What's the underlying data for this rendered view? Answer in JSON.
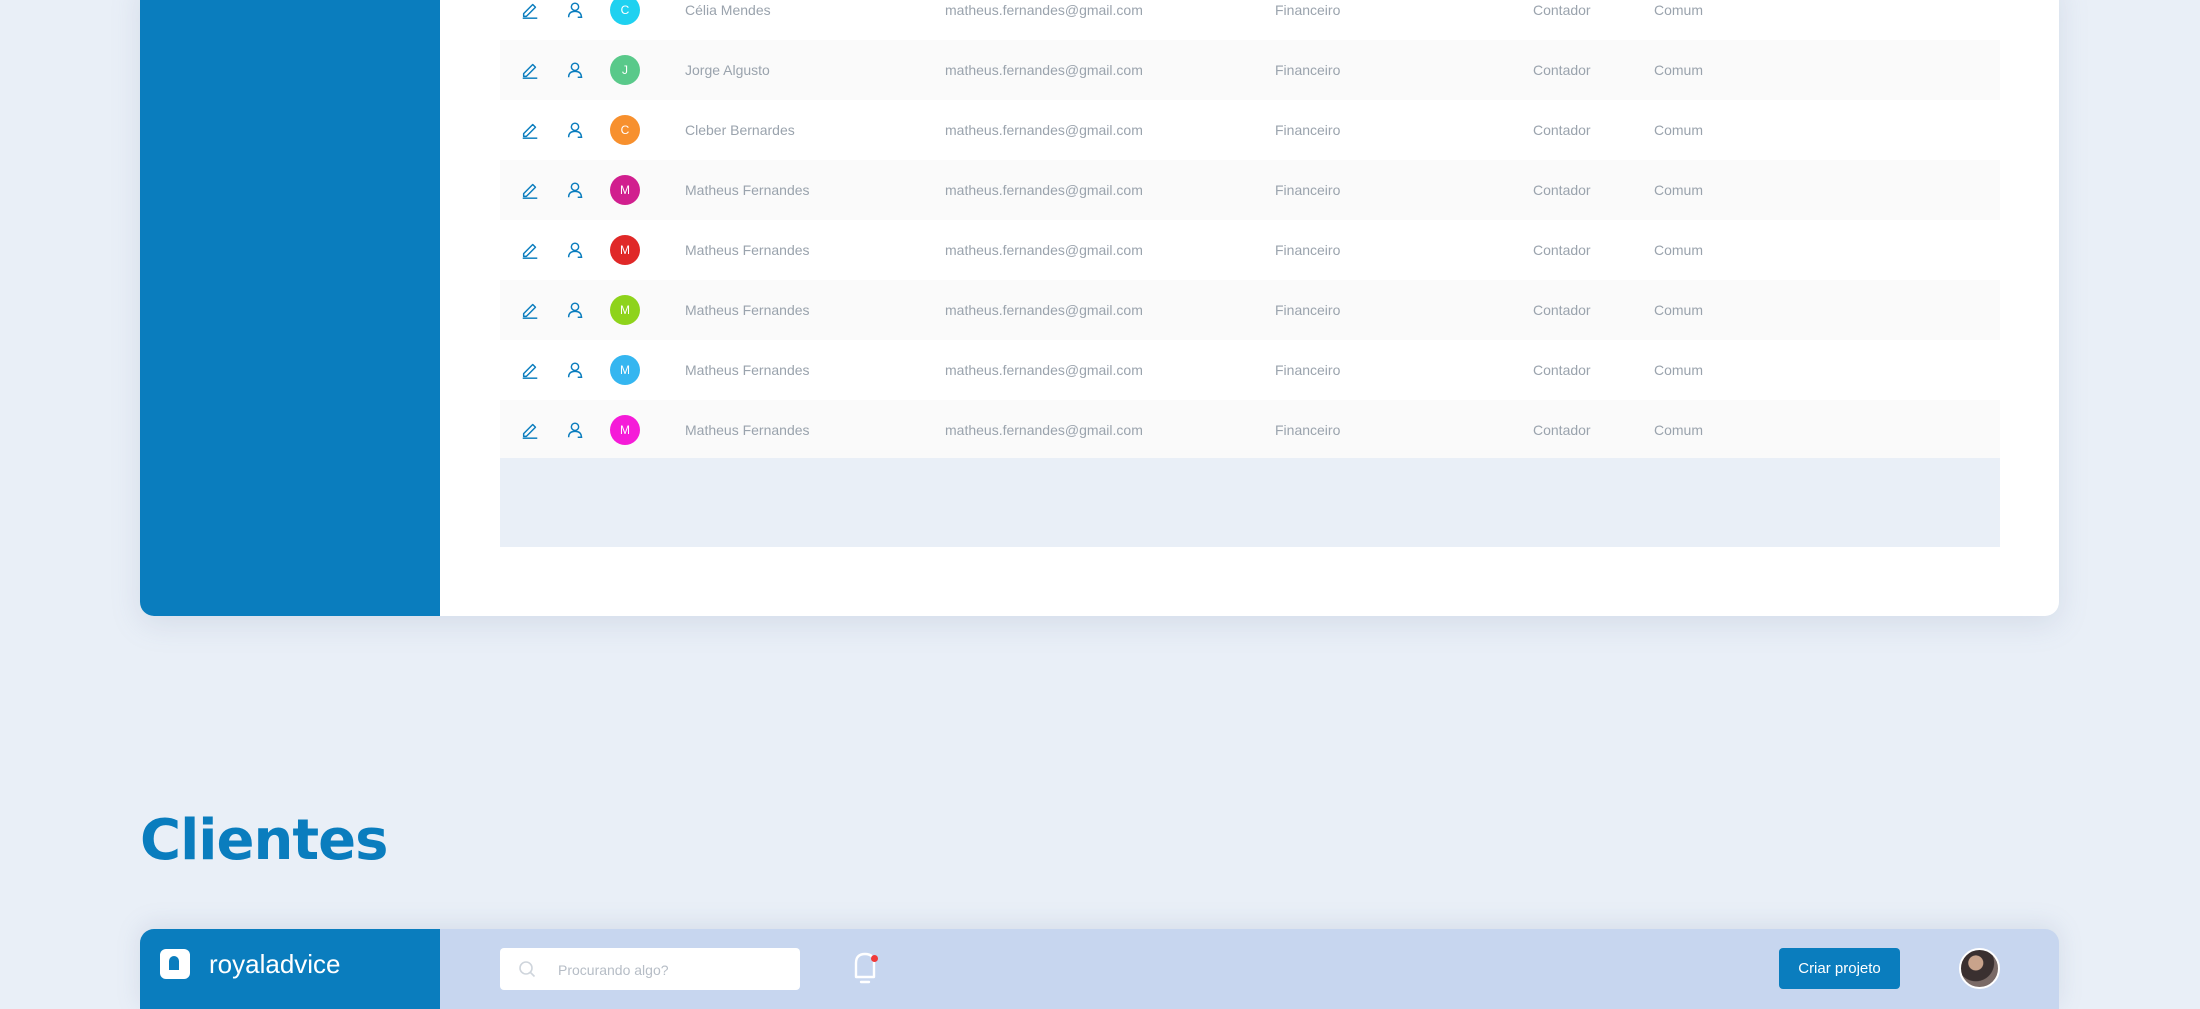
{
  "users_table": {
    "rows": [
      {
        "initial": "C",
        "name": "Célia Mendes",
        "email": "matheus.fernandes@gmail.com",
        "department": "Financeiro",
        "role": "Contador",
        "type": "Comum",
        "avatar_color": "#1fd1f0"
      },
      {
        "initial": "J",
        "name": "Jorge Algusto",
        "email": "matheus.fernandes@gmail.com",
        "department": "Financeiro",
        "role": "Contador",
        "type": "Comum",
        "avatar_color": "#59c98a"
      },
      {
        "initial": "C",
        "name": "Cleber Bernardes",
        "email": "matheus.fernandes@gmail.com",
        "department": "Financeiro",
        "role": "Contador",
        "type": "Comum",
        "avatar_color": "#f7902e"
      },
      {
        "initial": "M",
        "name": "Matheus Fernandes",
        "email": "matheus.fernandes@gmail.com",
        "department": "Financeiro",
        "role": "Contador",
        "type": "Comum",
        "avatar_color": "#d11f8e"
      },
      {
        "initial": "M",
        "name": "Matheus Fernandes",
        "email": "matheus.fernandes@gmail.com",
        "department": "Financeiro",
        "role": "Contador",
        "type": "Comum",
        "avatar_color": "#e02828"
      },
      {
        "initial": "M",
        "name": "Matheus Fernandes",
        "email": "matheus.fernandes@gmail.com",
        "department": "Financeiro",
        "role": "Contador",
        "type": "Comum",
        "avatar_color": "#8ed31b"
      },
      {
        "initial": "M",
        "name": "Matheus Fernandes",
        "email": "matheus.fernandes@gmail.com",
        "department": "Financeiro",
        "role": "Contador",
        "type": "Comum",
        "avatar_color": "#35b6f0"
      },
      {
        "initial": "M",
        "name": "Matheus Fernandes",
        "email": "matheus.fernandes@gmail.com",
        "department": "Financeiro",
        "role": "Contador",
        "type": "Comum",
        "avatar_color": "#f51bd8"
      }
    ],
    "icons": {
      "edit": "pencil-icon",
      "user": "user-icon"
    }
  },
  "section": {
    "title": "Clientes"
  },
  "header": {
    "logo_text": "royaladvice",
    "search_placeholder": "Procurando algo?",
    "cta_label": "Criar projeto"
  },
  "colors": {
    "brand": "#0a7dbe",
    "background": "#e9eff7",
    "header_bar": "#c7d6ef",
    "notification": "#f03a3a"
  }
}
